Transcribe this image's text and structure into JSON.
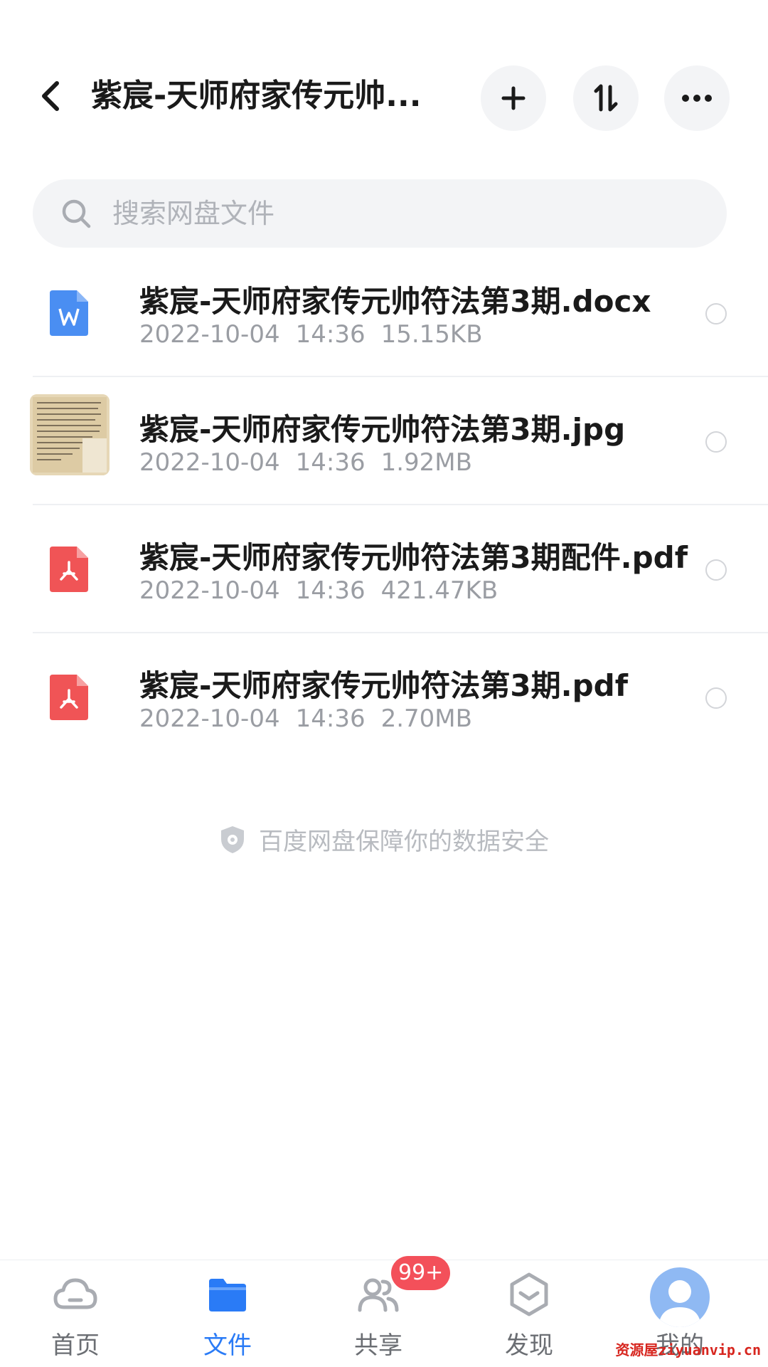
{
  "header": {
    "title": "紫宸-天师府家传元帅...",
    "icons": {
      "back": "chevron-left-icon",
      "add": "plus-icon",
      "sort": "sort-icon",
      "more": "more-icon"
    }
  },
  "search": {
    "placeholder": "搜索网盘文件",
    "icon": "search-icon"
  },
  "files": [
    {
      "name": "紫宸-天师府家传元帅符法第3期.docx",
      "date": "2022-10-04",
      "time": "14:36",
      "size": "15.15KB",
      "type": "docx"
    },
    {
      "name": "紫宸-天师府家传元帅符法第3期.jpg",
      "date": "2022-10-04",
      "time": "14:36",
      "size": "1.92MB",
      "type": "jpg"
    },
    {
      "name": "紫宸-天师府家传元帅符法第3期配件.pdf",
      "date": "2022-10-04",
      "time": "14:36",
      "size": "421.47KB",
      "type": "pdf"
    },
    {
      "name": "紫宸-天师府家传元帅符法第3期.pdf",
      "date": "2022-10-04",
      "time": "14:36",
      "size": "2.70MB",
      "type": "pdf"
    }
  ],
  "security_note": "百度网盘保障你的数据安全",
  "bottom_nav": [
    {
      "label": "首页",
      "icon": "cloud-icon",
      "active": false
    },
    {
      "label": "文件",
      "icon": "folder-icon",
      "active": true
    },
    {
      "label": "共享",
      "icon": "share-icon",
      "active": false,
      "badge": "99+"
    },
    {
      "label": "发现",
      "icon": "discover-icon",
      "active": false
    },
    {
      "label": "我的",
      "icon": "avatar-icon",
      "active": false
    }
  ],
  "watermark": "资源屋ziyuanvip.cn",
  "colors": {
    "accent": "#2a7bf6",
    "pdf": "#f05456",
    "docx": "#4a8ef2",
    "badge": "#f3505a"
  }
}
